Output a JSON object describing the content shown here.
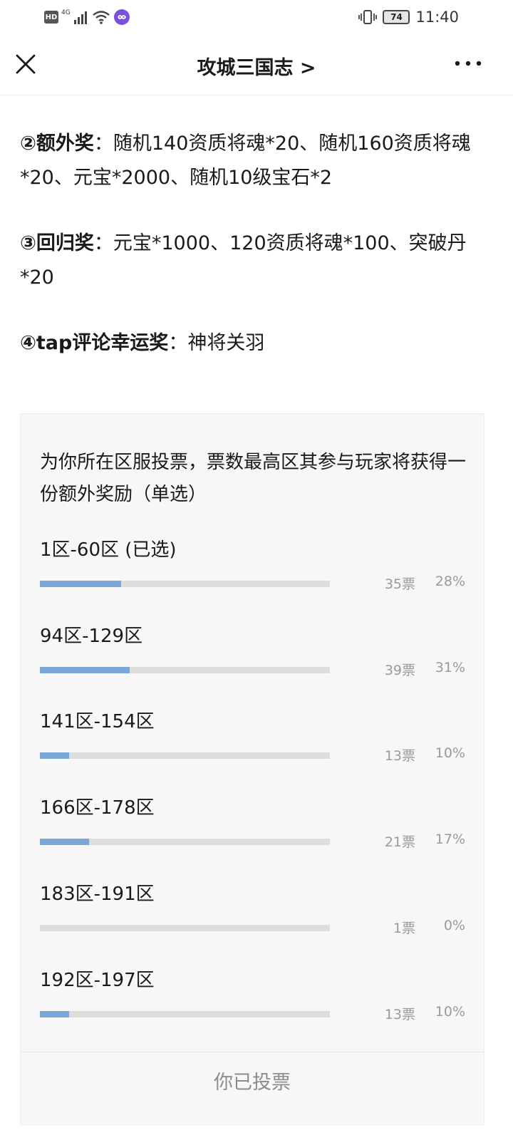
{
  "status_bar": {
    "hd": "HD",
    "network": "4G",
    "battery": "74",
    "time": "11:40"
  },
  "nav": {
    "title": "攻城三国志 >"
  },
  "content": {
    "p2_head": "②额外奖",
    "p2_body": "：随机140资质将魂*20、随机160资质将魂*20、元宝*2000、随机10级宝石*2",
    "p3_head": "③回归奖",
    "p3_body": "：元宝*1000、120资质将魂*100、突破丹*20",
    "p4_head": "④tap评论幸运奖",
    "p4_body": "：神将关羽"
  },
  "poll": {
    "question": "为你所在区服投票，票数最高区其参与玩家将获得一份额外奖励（单选）",
    "options": [
      {
        "label": "1区-60区 (已选)",
        "votes": "35票",
        "percent": "28%",
        "value": 0.28
      },
      {
        "label": "94区-129区",
        "votes": "39票",
        "percent": "31%",
        "value": 0.31
      },
      {
        "label": "141区-154区",
        "votes": "13票",
        "percent": "10%",
        "value": 0.1
      },
      {
        "label": "166区-178区",
        "votes": "21票",
        "percent": "17%",
        "value": 0.17
      },
      {
        "label": "183区-191区",
        "votes": "1票",
        "percent": "0%",
        "value": 0.0
      },
      {
        "label": "192区-197区",
        "votes": "13票",
        "percent": "10%",
        "value": 0.1
      }
    ],
    "footer": "你已投票"
  },
  "colors": {
    "bar_fill": "#7aa7d8",
    "bar_track": "#dddddd"
  }
}
